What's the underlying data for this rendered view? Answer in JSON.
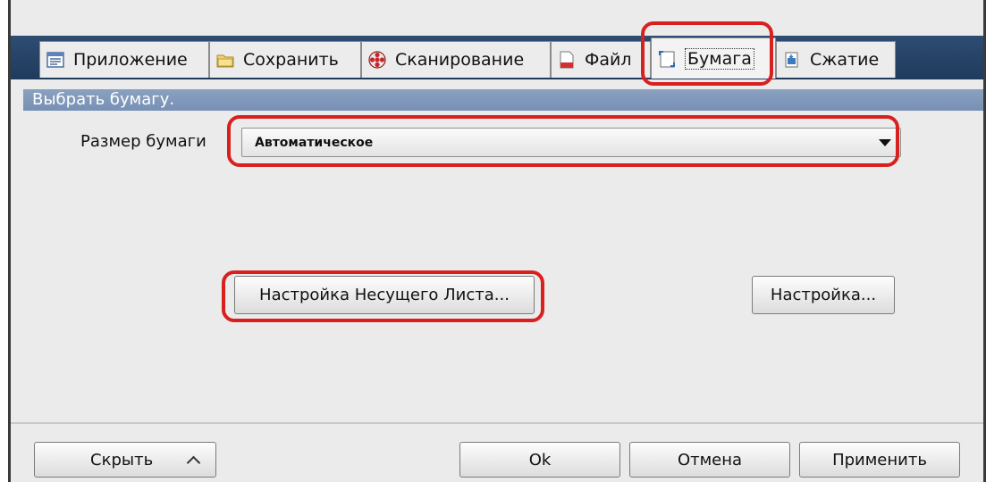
{
  "tabs": [
    {
      "label": "Приложение",
      "icon": "application-icon"
    },
    {
      "label": "Сохранить",
      "icon": "folder-icon"
    },
    {
      "label": "Сканирование",
      "icon": "scan-icon"
    },
    {
      "label": "Файл",
      "icon": "file-icon"
    },
    {
      "label": "Бумага",
      "icon": "paper-icon",
      "active": true
    },
    {
      "label": "Сжатие",
      "icon": "compression-icon"
    }
  ],
  "section": {
    "title": "Выбрать бумагу."
  },
  "paper_size": {
    "label": "Размер бумаги",
    "value": "Автоматическое"
  },
  "buttons": {
    "carrier_sheet": "Настройка Несущего Листа...",
    "settings": "Настройка...",
    "hide": "Скрыть",
    "ok": "Ok",
    "cancel": "Отмена",
    "apply": "Применить"
  },
  "colors": {
    "highlight": "#d8201f",
    "tabstrip": "#2e4d72",
    "section_band": "#7f97b9"
  }
}
